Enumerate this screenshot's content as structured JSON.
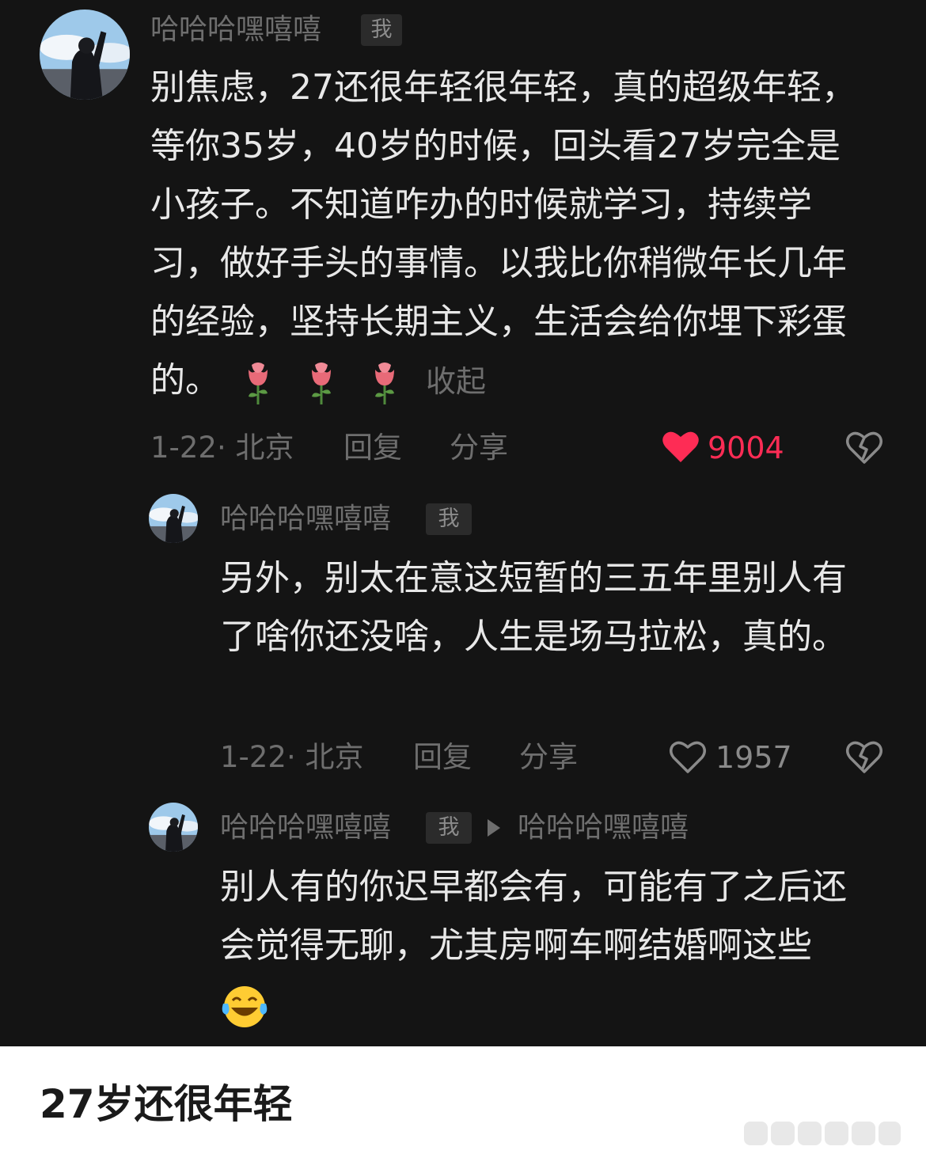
{
  "comments": [
    {
      "username": "哈哈哈嘿嘻嘻",
      "badge": "我",
      "text": "别焦虑，27还很年轻很年轻，真的超级年轻，等你35岁，40岁的时候，回头看27岁完全是小孩子。不知道咋办的时候就学习，持续学习，做好手头的事情。以我比你稍微年长几年的经验，坚持长期主义，生活会给你埋下彩蛋的。",
      "emoji": [
        "rose-emoji",
        "rose-emoji",
        "rose-emoji"
      ],
      "collapse": "收起",
      "date_location": "1-22· 北京",
      "reply": "回复",
      "share": "分享",
      "likes": "9004",
      "liked": true,
      "like_color": "#fe2c55"
    },
    {
      "username": "哈哈哈嘿嘻嘻",
      "badge": "我",
      "text": "另外，别太在意这短暂的三五年里别人有了啥你还没啥，人生是场马拉松，真的。",
      "date_location": "1-22· 北京",
      "reply": "回复",
      "share": "分享",
      "likes": "1957",
      "liked": false
    },
    {
      "username": "哈哈哈嘿嘻嘻",
      "badge": "我",
      "reply_to": "哈哈哈嘿嘻嘻",
      "text": "别人有的你迟早都会有，可能有了之后还会觉得无聊，尤其房啊车啊结婚啊这些",
      "emoji": [
        "laughing-tears-emoji"
      ]
    }
  ],
  "icons": {
    "like": "heart-icon",
    "dislike": "broken-heart-icon",
    "reply_arrow": "triangle-right-icon"
  },
  "caption": "27岁还很年轻"
}
